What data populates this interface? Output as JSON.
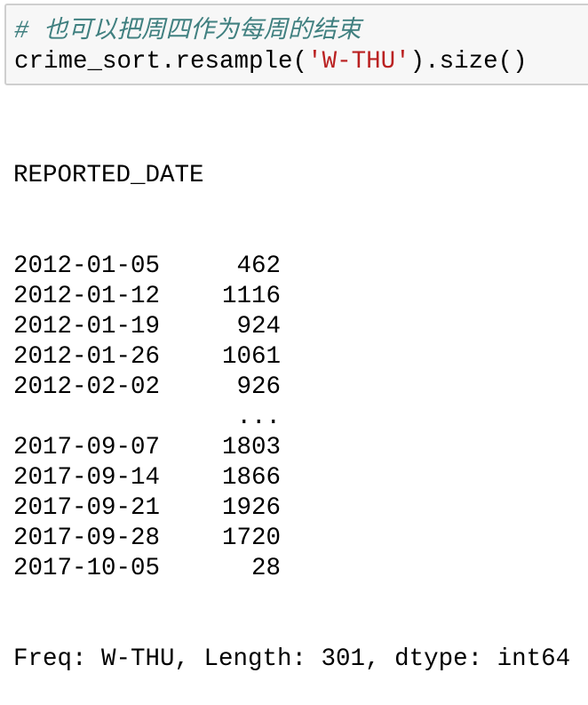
{
  "input": {
    "comment": "# 也可以把周四作为每周的结束",
    "code_prefix": "crime_sort.resample(",
    "code_string": "'W-THU'",
    "code_suffix": ").size()"
  },
  "output": {
    "index_name": "REPORTED_DATE",
    "rows": [
      {
        "date": "2012-01-05",
        "value": "462"
      },
      {
        "date": "2012-01-12",
        "value": "1116"
      },
      {
        "date": "2012-01-19",
        "value": "924"
      },
      {
        "date": "2012-01-26",
        "value": "1061"
      },
      {
        "date": "2012-02-02",
        "value": "926"
      },
      {
        "date": "",
        "value": "..."
      },
      {
        "date": "2017-09-07",
        "value": "1803"
      },
      {
        "date": "2017-09-14",
        "value": "1866"
      },
      {
        "date": "2017-09-21",
        "value": "1926"
      },
      {
        "date": "2017-09-28",
        "value": "1720"
      },
      {
        "date": "2017-10-05",
        "value": "28"
      }
    ],
    "footer": "Freq: W-THU, Length: 301, dtype: int64"
  }
}
